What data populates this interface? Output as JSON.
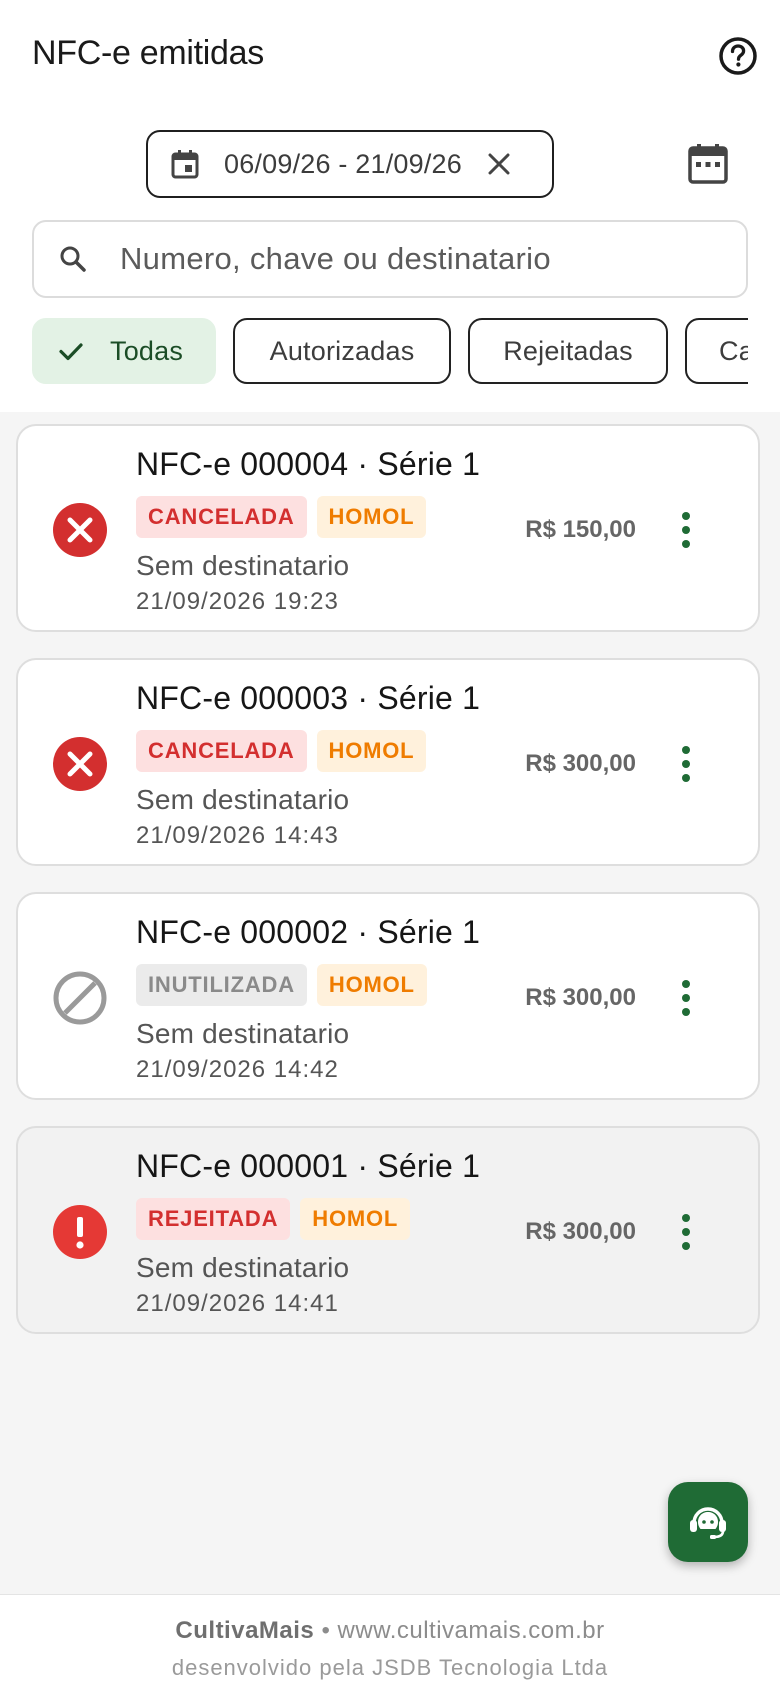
{
  "header": {
    "title": "NFC-e emitidas"
  },
  "date_filter": {
    "range": "06/09/26 - 21/09/26"
  },
  "search": {
    "placeholder": "Numero, chave ou destinatario"
  },
  "filters": [
    {
      "label": "Todas",
      "selected": true
    },
    {
      "label": "Autorizadas",
      "selected": false
    },
    {
      "label": "Rejeitadas",
      "selected": false
    },
    {
      "label": "Canceladas",
      "selected": false
    }
  ],
  "invoices": [
    {
      "title": "NFC-e 000004 · Série 1",
      "status": "CANCELADA",
      "env": "HOMOL",
      "recipient": "Sem destinatario",
      "datetime": "21/09/2026 19:23",
      "value": "R$ 150,00",
      "status_icon": "cancel-x-icon"
    },
    {
      "title": "NFC-e 000003 · Série 1",
      "status": "CANCELADA",
      "env": "HOMOL",
      "recipient": "Sem destinatario",
      "datetime": "21/09/2026 14:43",
      "value": "R$ 300,00",
      "status_icon": "cancel-x-icon"
    },
    {
      "title": "NFC-e 000002 · Série 1",
      "status": "INUTILIZADA",
      "env": "HOMOL",
      "recipient": "Sem destinatario",
      "datetime": "21/09/2026 14:42",
      "value": "R$ 300,00",
      "status_icon": "block-icon"
    },
    {
      "title": "NFC-e 000001 · Série 1",
      "status": "REJEITADA",
      "env": "HOMOL",
      "recipient": "Sem destinatario",
      "datetime": "21/09/2026 14:41",
      "value": "R$ 300,00",
      "status_icon": "error-exclamation-icon"
    }
  ],
  "footer": {
    "brand": "CultivaMais",
    "separator": "•",
    "url": "www.cultivamais.com.br",
    "credit": "desenvolvido pela JSDB Tecnologia Ltda"
  },
  "colors": {
    "accent_green": "#1f6b35",
    "error_red": "#d32f2f",
    "homol_orange": "#ef7c00",
    "selected_chip_bg": "#e3f2e5"
  }
}
